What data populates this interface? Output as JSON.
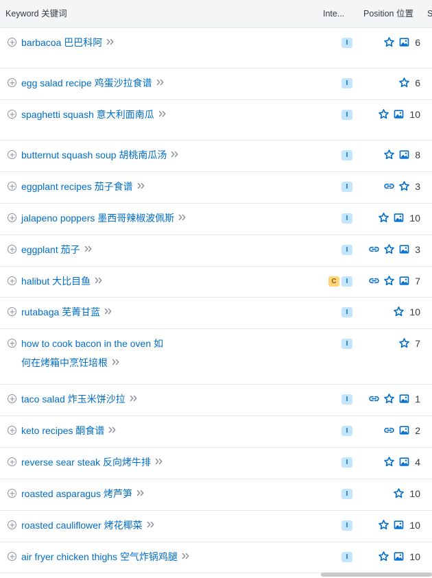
{
  "header": {
    "keyword_label": "Keyword 关键词",
    "intent_label": "Inte...",
    "position_label": "Position 位置",
    "sv_label": "S"
  },
  "rows": [
    {
      "keyword": "barbacoa 巴巴科阿",
      "intents": [
        "I"
      ],
      "features": [
        "star",
        "image"
      ],
      "position": "6"
    },
    {
      "keyword": "egg salad recipe 鸡蛋沙拉食谱",
      "intents": [
        "I"
      ],
      "features": [
        "star"
      ],
      "position": "6"
    },
    {
      "keyword": "spaghetti squash 意大利面南瓜",
      "intents": [
        "I"
      ],
      "features": [
        "star",
        "image"
      ],
      "position": "10"
    },
    {
      "keyword": "butternut squash soup 胡桃南瓜汤",
      "intents": [
        "I"
      ],
      "features": [
        "star",
        "image"
      ],
      "position": "8"
    },
    {
      "keyword": "eggplant recipes 茄子食谱",
      "intents": [
        "I"
      ],
      "features": [
        "link",
        "star"
      ],
      "position": "3"
    },
    {
      "keyword": "jalapeno poppers 墨西哥辣椒波佩斯",
      "intents": [
        "I"
      ],
      "features": [
        "star",
        "image"
      ],
      "position": "10"
    },
    {
      "keyword": "eggplant 茄子",
      "intents": [
        "I"
      ],
      "features": [
        "link",
        "star",
        "image"
      ],
      "position": "3"
    },
    {
      "keyword": "halibut 大比目鱼",
      "intents": [
        "C",
        "I"
      ],
      "features": [
        "link",
        "star",
        "image"
      ],
      "position": "7"
    },
    {
      "keyword": "rutabaga 芜菁甘蓝",
      "intents": [
        "I"
      ],
      "features": [
        "star"
      ],
      "position": "10"
    },
    {
      "keyword": "how to cook bacon in the oven 如何在烤箱中烹饪培根",
      "intents": [
        "I"
      ],
      "features": [
        "star"
      ],
      "position": "7"
    },
    {
      "keyword": "taco salad 炸玉米饼沙拉",
      "intents": [
        "I"
      ],
      "features": [
        "link",
        "star",
        "image"
      ],
      "position": "1"
    },
    {
      "keyword": "keto recipes 酮食谱",
      "intents": [
        "I"
      ],
      "features": [
        "link",
        "image"
      ],
      "position": "2"
    },
    {
      "keyword": "reverse sear steak 反向烤牛排",
      "intents": [
        "I"
      ],
      "features": [
        "star",
        "image"
      ],
      "position": "4"
    },
    {
      "keyword": "roasted asparagus 烤芦笋",
      "intents": [
        "I"
      ],
      "features": [
        "star"
      ],
      "position": "10"
    },
    {
      "keyword": "roasted cauliflower 烤花椰菜",
      "intents": [
        "I"
      ],
      "features": [
        "star",
        "image"
      ],
      "position": "10"
    },
    {
      "keyword": "air fryer chicken thighs 空气炸锅鸡腿",
      "intents": [
        "I"
      ],
      "features": [
        "star",
        "image"
      ],
      "position": "10"
    }
  ]
}
